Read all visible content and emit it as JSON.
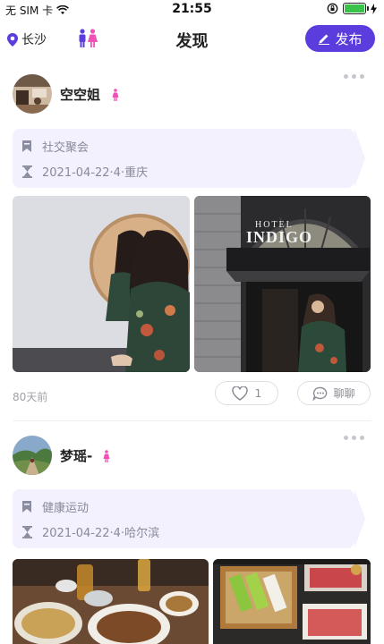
{
  "status_bar": {
    "carrier": "无 SIM 卡",
    "time": "21:55"
  },
  "header": {
    "location": "长沙",
    "title": "发现",
    "publish_label": "发布"
  },
  "colors": {
    "accent": "#5b3cdd",
    "tag_background": "#f2f1fd",
    "female_pink": "#ef52b5"
  },
  "posts": [
    {
      "username": "空空姐",
      "gender_icon": "female-icon",
      "category": "社交聚会",
      "event_info": "2021-04-22·4·重庆",
      "time_ago": "80天前",
      "likes": "1",
      "chat_label": "聊聊"
    },
    {
      "username": "梦瑶-",
      "gender_icon": "female-icon",
      "category": "健康运动",
      "event_info": "2021-04-22·4·哈尔滨"
    }
  ],
  "photo_texts": {
    "hotel_small": "HOTEL",
    "hotel_big": "INDIGO"
  }
}
